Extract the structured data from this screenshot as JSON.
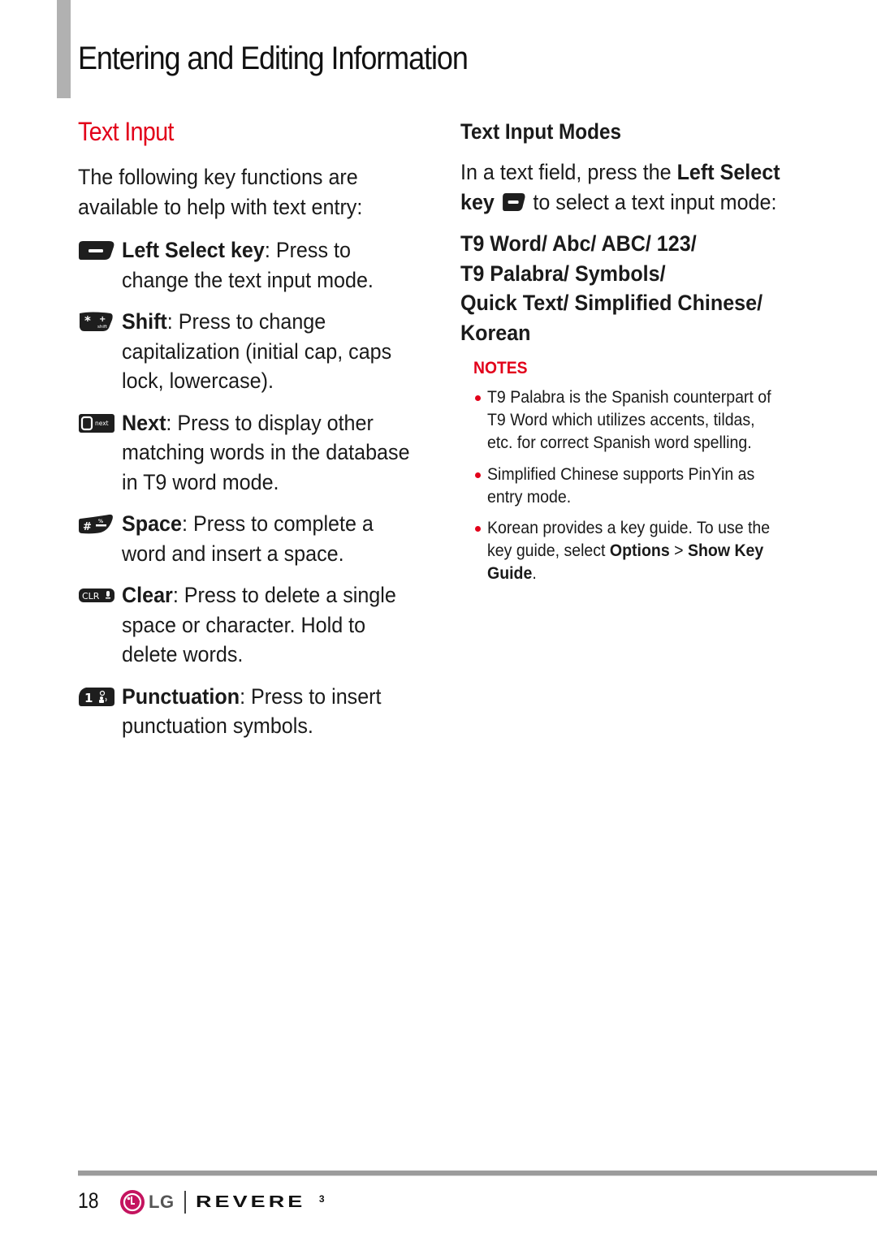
{
  "header": {
    "title": "Entering and Editing Information"
  },
  "section": {
    "title": "Text Input"
  },
  "left_column": {
    "intro": "The following key functions are available to help with text entry:",
    "keys": [
      {
        "icon": "left-select-key-icon",
        "name": "Left Select key",
        "separator": ": ",
        "description": "Press to change the text input mode."
      },
      {
        "icon": "shift-key-icon",
        "name": "Shift",
        "separator": ": ",
        "description": "Press to change capitalization (initial cap, caps lock, lowercase)."
      },
      {
        "icon": "next-key-icon",
        "name": "Next",
        "separator": ": ",
        "description": "Press to display other matching words in the database in T9 word mode."
      },
      {
        "icon": "space-key-icon",
        "name": "Space",
        "separator": ": ",
        "description": "Press to complete a word and insert a space."
      },
      {
        "icon": "clear-key-icon",
        "name": "Clear",
        "separator": ": ",
        "description": "Press to delete a single space or character. Hold to delete words."
      },
      {
        "icon": "punctuation-key-icon",
        "name": "Punctuation",
        "separator": ": ",
        "description": "Press to insert punctuation symbols."
      }
    ],
    "key_icon_labels": {
      "shift_symbol": "*",
      "shift_small": "shift",
      "next_small": "next",
      "space_symbol": "#",
      "clear_label": "CLR",
      "punct_number": "1"
    }
  },
  "right_column": {
    "title": "Text Input Modes",
    "intro_before": "In a text field, press the ",
    "intro_key_name": "Left Select",
    "intro_key_word": "key",
    "intro_after": " to select a text input mode:",
    "modes_text": "T9 Word/ Abc/ ABC/ 123/ T9 Palabra/ Symbols/ Quick Text/ Simplified Chinese/ Korean",
    "modes_lines": [
      "T9 Word/ Abc/ ABC/ 123/",
      "T9 Palabra/ Symbols/",
      "Quick Text/ Simplified Chinese/",
      "Korean"
    ],
    "notes_label": "NOTES",
    "notes": [
      {
        "text": "T9 Palabra is the Spanish counterpart of T9 Word which utilizes accents, tildas, etc. for correct Spanish word spelling."
      },
      {
        "text": "Simplified Chinese supports PinYin as entry mode."
      },
      {
        "before": "Korean provides a key guide. To use the key guide, select ",
        "bold1": "Options",
        "middle": " > ",
        "bold2": "Show Key Guide",
        "after": "."
      }
    ]
  },
  "footer": {
    "page_number": "18",
    "brand": "LG",
    "product": "REVERE",
    "product_version": "3"
  },
  "colors": {
    "accent_red": "#e2001a",
    "lg_magenta": "#c4145f",
    "rule_grey": "#9c9c9c",
    "side_bar_grey": "#b1b1b1"
  }
}
